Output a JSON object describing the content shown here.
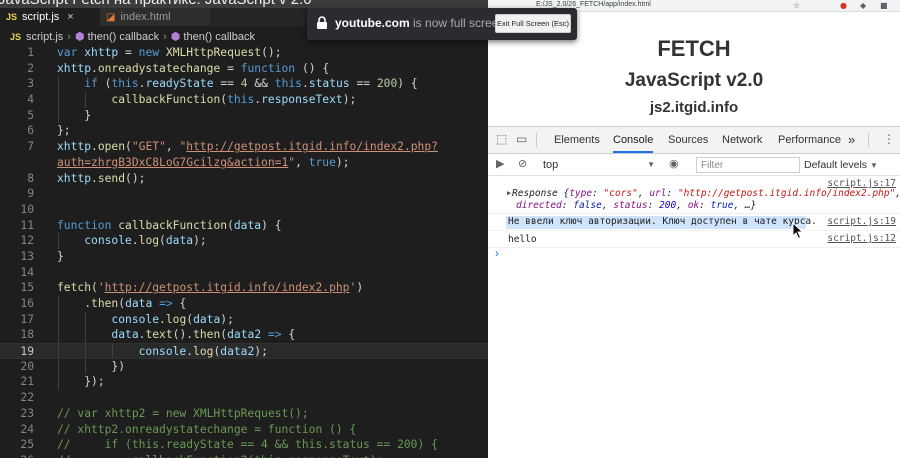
{
  "editor": {
    "window_title": "JavaScript Fetch на практике. JavaScript v 2.0",
    "tabs": [
      {
        "label": "script.js",
        "active": true
      },
      {
        "label": "index.html",
        "active": false
      }
    ],
    "breadcrumb": [
      "script.js",
      "then() callback",
      "then() callback"
    ],
    "current_line": 19
  },
  "browser": {
    "url": "E:/JS_2.0/26_FETCH/app/index.html",
    "page": {
      "title": "FETCH",
      "subtitle": "JavaScript v2.0",
      "site": "js2.itgid.info"
    },
    "devtools": {
      "tabs": [
        "Elements",
        "Console",
        "Sources",
        "Network",
        "Performance"
      ],
      "active_tab": "Console",
      "more": "»",
      "context": "top",
      "filter_placeholder": "Filter",
      "levels": "Default levels",
      "messages": [
        {
          "source": "script.js:17"
        },
        {
          "source": "script.js:19",
          "text": "Не ввели ключ авторизации. Ключ доступен в чате курса."
        },
        {
          "source": "script.js:12",
          "text": "hello"
        }
      ]
    }
  },
  "fullscreen_notice": {
    "domain": "youtube.com",
    "message": "is now full screen",
    "exit_label": "Exit Full Screen (Esc)"
  }
}
